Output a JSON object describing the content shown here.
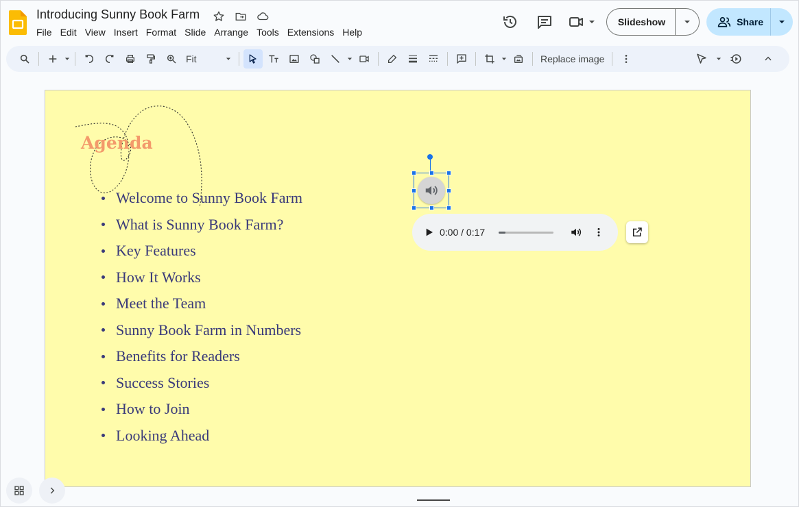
{
  "app": {
    "doc_title": "Introducing Sunny Book Farm",
    "brand_color": "#fbbc04"
  },
  "menu": [
    "File",
    "Edit",
    "View",
    "Insert",
    "Format",
    "Slide",
    "Arrange",
    "Tools",
    "Extensions",
    "Help"
  ],
  "header_actions": {
    "slideshow_label": "Slideshow",
    "share_label": "Share"
  },
  "toolbar": {
    "zoom_value": "Fit",
    "replace_image_label": "Replace image"
  },
  "slide": {
    "background": "#fffcab",
    "heading": "Agenda",
    "items": [
      "Welcome to Sunny Book Farm",
      "What is Sunny Book Farm?",
      "Key Features",
      "How It Works",
      "Meet the Team",
      "Sunny Book Farm in Numbers",
      "Benefits for Readers",
      "Success Stories",
      "How to Join",
      "Looking Ahead"
    ]
  },
  "audio": {
    "time_display": "0:00 / 0:17",
    "progress_fraction": 0.0
  }
}
